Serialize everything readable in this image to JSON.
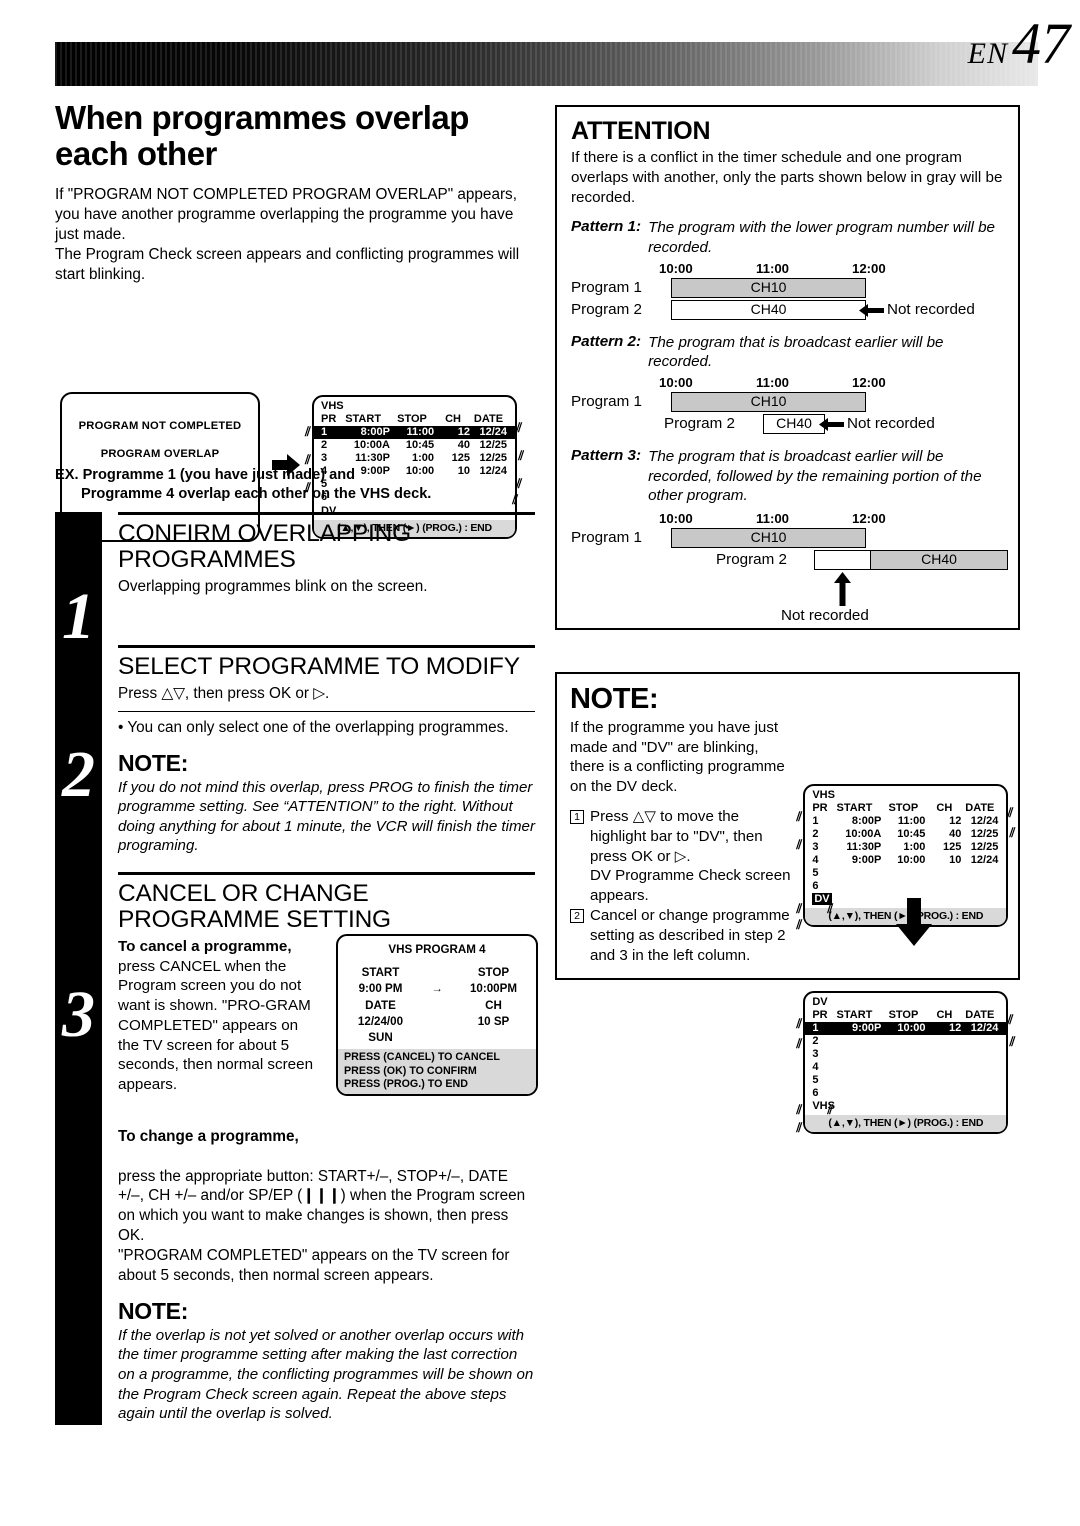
{
  "page": {
    "lang_code": "EN",
    "number": "47"
  },
  "left": {
    "title": "When programmes overlap each other",
    "intro": "If \"PROGRAM NOT COMPLETED PROGRAM OVERLAP\" appears, you have another programme overlapping the programme you have just made.\nThe Program Check screen appears and conflicting programmes will start blinking.",
    "osd_message": {
      "line1": "PROGRAM NOT COMPLETED",
      "line2": "PROGRAM OVERLAP"
    },
    "example_line1": "EX. Programme 1 (you have just made) and",
    "example_line2": "Programme 4 overlap each other on the VHS deck.",
    "steps": [
      {
        "number": "1",
        "heading": "CONFIRM OVERLAPPING PROGRAMMES",
        "body": "Overlapping programmes blink on the screen."
      },
      {
        "number": "2",
        "heading": "SELECT PROGRAMME TO MODIFY",
        "body": "Press △▽, then press OK or ▷.",
        "bullet": "• You can only select one of the overlapping programmes.",
        "note_label": "NOTE:",
        "note": "If you do not mind this overlap, press PROG to finish the timer programme setting. See “ATTENTION” to the right. Without doing anything for about 1 minute, the VCR will finish the timer programing."
      },
      {
        "number": "3",
        "heading": "CANCEL OR CHANGE PROGRAMME SETTING",
        "cancel_label": "To cancel a programme,",
        "cancel_text": "press CANCEL when the Program screen you do not want is shown. \"PRO-GRAM COMPLETED\" appears on the TV screen for about 5 seconds, then normal screen appears.",
        "change_label": "To change a programme,",
        "change_text": "press the appropriate button: START+/–, STOP+/–, DATE +/–, CH +/– and/or SP/EP (❙❙❙) when the Program screen on which you want to make changes is shown, then press OK.\n\"PROGRAM COMPLETED\" appears on the TV screen for about 5 seconds, then normal screen appears.",
        "note_label": "NOTE:",
        "note": "If the overlap is not yet solved or another overlap occurs with the timer programme setting after making the last correction on a programme, the conflicting programmes will be shown on the Program Check screen again. Repeat the above steps again until the overlap is solved."
      }
    ],
    "vhs_program_screen": {
      "title": "VHS PROGRAM 4",
      "start_label": "START",
      "stop_label": "STOP",
      "start_value": "9:00 PM",
      "arrow": "→",
      "stop_value": "10:00PM",
      "date_label": "DATE",
      "ch_label": "CH",
      "date_value": "12/24/00",
      "ch_value": "10  SP",
      "day_value": "SUN",
      "footer": [
        "PRESS (CANCEL) TO CANCEL",
        "PRESS (OK) TO CONFIRM",
        "PRESS (PROG.) TO END"
      ]
    }
  },
  "program_check": {
    "deck": "VHS",
    "columns": [
      "PR",
      "START",
      "STOP",
      "CH",
      "DATE"
    ],
    "rows": [
      {
        "pr": "1",
        "start": "8:00P",
        "stop": "11:00",
        "ch": "12",
        "date": "12/24",
        "selected": true
      },
      {
        "pr": "2",
        "start": "10:00A",
        "stop": "10:45",
        "ch": "40",
        "date": "12/25",
        "selected": false
      },
      {
        "pr": "3",
        "start": "11:30P",
        "stop": "1:00",
        "ch": "125",
        "date": "12/25",
        "selected": false
      },
      {
        "pr": "4",
        "start": "9:00P",
        "stop": "10:00",
        "ch": "10",
        "date": "12/24",
        "selected": false
      },
      {
        "pr": "5",
        "start": "",
        "stop": "",
        "ch": "",
        "date": "",
        "selected": false
      },
      {
        "pr": "6",
        "start": "",
        "stop": "",
        "ch": "",
        "date": "",
        "selected": false
      }
    ],
    "other_deck": "DV",
    "footer": "(▲,▼), THEN (►) (PROG.) : END"
  },
  "program_check_dvsel": {
    "deck": "VHS",
    "columns": [
      "PR",
      "START",
      "STOP",
      "CH",
      "DATE"
    ],
    "rows": [
      {
        "pr": "1",
        "start": "8:00P",
        "stop": "11:00",
        "ch": "12",
        "date": "12/24",
        "selected": false
      },
      {
        "pr": "2",
        "start": "10:00A",
        "stop": "10:45",
        "ch": "40",
        "date": "12/25",
        "selected": false
      },
      {
        "pr": "3",
        "start": "11:30P",
        "stop": "1:00",
        "ch": "125",
        "date": "12/25",
        "selected": false
      },
      {
        "pr": "4",
        "start": "9:00P",
        "stop": "10:00",
        "ch": "10",
        "date": "12/24",
        "selected": false
      },
      {
        "pr": "5",
        "start": "",
        "stop": "",
        "ch": "",
        "date": "",
        "selected": false
      },
      {
        "pr": "6",
        "start": "",
        "stop": "",
        "ch": "",
        "date": "",
        "selected": false
      }
    ],
    "other_deck": "DV",
    "footer": "(▲,▼), THEN (►) (PROG.) : END"
  },
  "program_check_dv": {
    "deck": "DV",
    "columns": [
      "PR",
      "START",
      "STOP",
      "CH",
      "DATE"
    ],
    "rows": [
      {
        "pr": "1",
        "start": "9:00P",
        "stop": "10:00",
        "ch": "12",
        "date": "12/24",
        "selected": true
      },
      {
        "pr": "2",
        "start": "",
        "stop": "",
        "ch": "",
        "date": "",
        "selected": false
      },
      {
        "pr": "3",
        "start": "",
        "stop": "",
        "ch": "",
        "date": "",
        "selected": false
      },
      {
        "pr": "4",
        "start": "",
        "stop": "",
        "ch": "",
        "date": "",
        "selected": false
      },
      {
        "pr": "5",
        "start": "",
        "stop": "",
        "ch": "",
        "date": "",
        "selected": false
      },
      {
        "pr": "6",
        "start": "",
        "stop": "",
        "ch": "",
        "date": "",
        "selected": false
      }
    ],
    "other_deck": "VHS",
    "footer": "(▲,▼), THEN (►) (PROG.) : END"
  },
  "attention": {
    "heading": "ATTENTION",
    "intro": "If there is a conflict in the timer schedule and one program overlaps with another, only the parts shown below in gray will be recorded.",
    "patterns": [
      {
        "label": "Pattern 1:",
        "text": "The program with the lower program number will be recorded."
      },
      {
        "label": "Pattern 2:",
        "text": "The program that is broadcast earlier will be recorded."
      },
      {
        "label": "Pattern 3:",
        "text": "The program that is broadcast earlier will be recorded, followed by the remaining portion of the other program."
      }
    ],
    "ticks": [
      "10:00",
      "11:00",
      "12:00"
    ],
    "program1_label": "Program 1",
    "program2_label": "Program 2",
    "ch10": "CH10",
    "ch40": "CH40",
    "not_recorded": "Not recorded"
  },
  "note_right": {
    "heading": "NOTE:",
    "intro": "If the programme you have just made and \"DV\" are blinking, there is a conflicting programme on the DV deck.",
    "items": [
      {
        "num": "1",
        "text": "Press △▽ to move the highlight bar to \"DV\", then press OK or ▷.\nDV Programme Check screen appears."
      },
      {
        "num": "2",
        "text": "Cancel or change programme setting as described in step 2 and 3 in the left column."
      }
    ]
  },
  "icons": {
    "arrow_right": "fat-right-arrow-icon",
    "arrow_down": "fat-down-arrow-icon",
    "blink_mark": "blink-mark-icon"
  },
  "colors": {
    "gray_fill": "#c8c8c8",
    "osd_footer_gray": "#d9d9d9",
    "black": "#000000"
  }
}
